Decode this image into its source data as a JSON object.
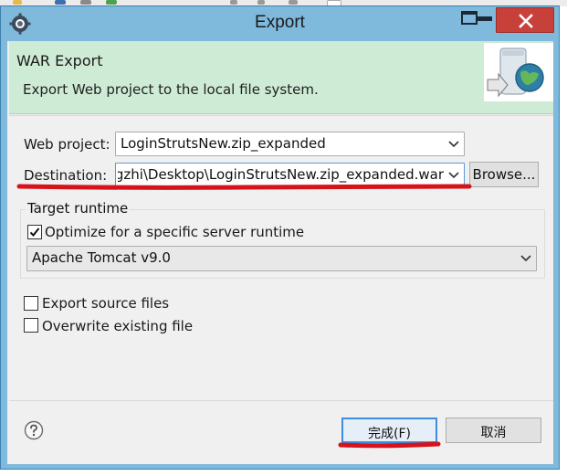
{
  "window": {
    "title": "Export"
  },
  "banner": {
    "title": "WAR Export",
    "description": "Export Web project to the local file system."
  },
  "form": {
    "web_project_label": "Web project:",
    "web_project_value": "LoginStrutsNew.zip_expanded",
    "destination_label": "Destination:",
    "destination_value": "gzhi\\Desktop\\LoginStrutsNew.zip_expanded.war",
    "browse_label": "Browse..."
  },
  "target_runtime": {
    "group_title": "Target runtime",
    "optimize_label": "Optimize for a specific server runtime",
    "optimize_checked": true,
    "runtime_value": "Apache Tomcat v9.0"
  },
  "options": {
    "export_source_label": "Export source files",
    "export_source_checked": false,
    "overwrite_label": "Overwrite existing file",
    "overwrite_checked": false
  },
  "footer": {
    "finish_label": "完成(F)",
    "cancel_label": "取消"
  },
  "colors": {
    "banner_bg": "#cdebd5",
    "window_frame": "#7fbadc",
    "close_button": "#c8403a",
    "annotation_red": "#d6131b",
    "focus_blue": "#3c8de0"
  }
}
